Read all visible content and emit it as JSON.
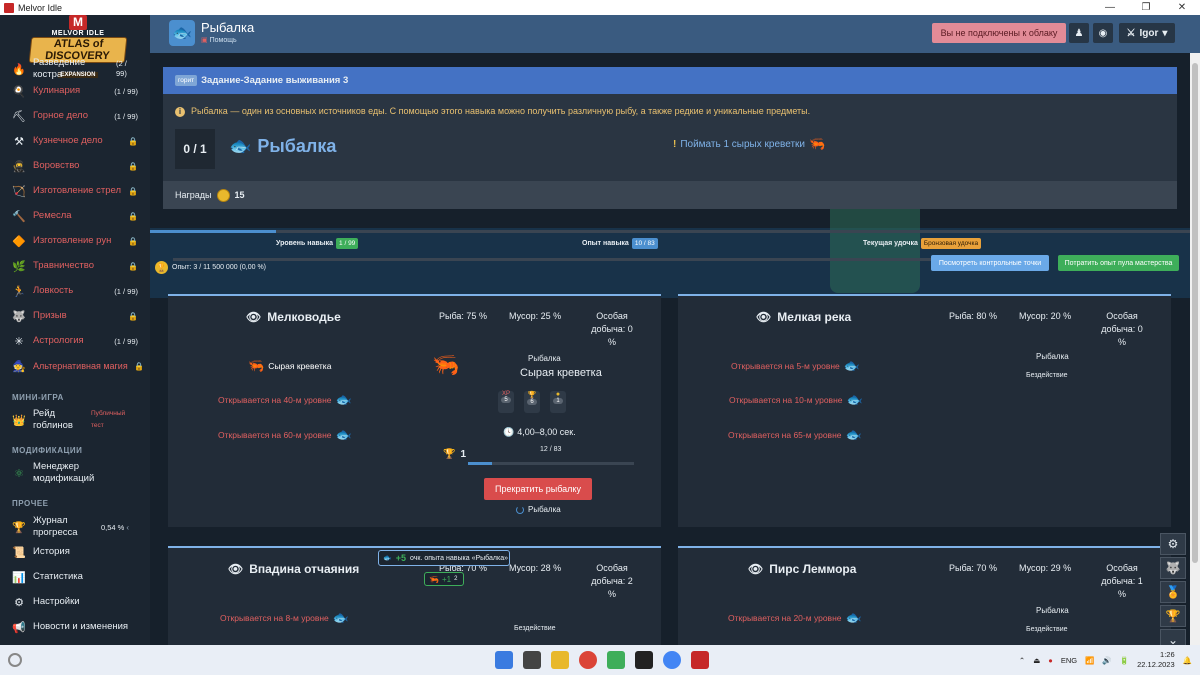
{
  "window": {
    "title": "Melvor Idle",
    "min": "—",
    "max": "❐",
    "close": "✕"
  },
  "logo": {
    "line1": "MELVOR IDLE",
    "line2": "ATLAS of DISCOVERY",
    "line3": "EXPANSION"
  },
  "sidebar": {
    "skills": [
      {
        "label": "Разведение костра",
        "count": "(2 / 99)",
        "locked": false,
        "icon": "flame-icon",
        "glyph": "🔥"
      },
      {
        "label": "Кулинария",
        "count": "(1 / 99)",
        "locked": false,
        "icon": "chef-hat-icon",
        "glyph": "🍳"
      },
      {
        "label": "Горное дело",
        "count": "(1 / 99)",
        "locked": false,
        "icon": "pickaxe-icon",
        "glyph": "⛏"
      },
      {
        "label": "Кузнечное дело",
        "count": "",
        "locked": true,
        "icon": "anvil-icon",
        "glyph": "⚒"
      },
      {
        "label": "Воровство",
        "count": "",
        "locked": true,
        "icon": "thief-icon",
        "glyph": "🥷"
      },
      {
        "label": "Изготовление стрел",
        "count": "",
        "locked": true,
        "icon": "arrows-icon",
        "glyph": "🏹"
      },
      {
        "label": "Ремесла",
        "count": "",
        "locked": true,
        "icon": "crafting-icon",
        "glyph": "🔨"
      },
      {
        "label": "Изготовление рун",
        "count": "",
        "locked": true,
        "icon": "rune-icon",
        "glyph": "🔶"
      },
      {
        "label": "Травничество",
        "count": "",
        "locked": true,
        "icon": "herb-icon",
        "glyph": "🌿"
      },
      {
        "label": "Ловкость",
        "count": "(1 / 99)",
        "locked": false,
        "icon": "agility-icon",
        "glyph": "🏃"
      },
      {
        "label": "Призыв",
        "count": "",
        "locked": true,
        "icon": "wolf-icon",
        "glyph": "🐺"
      },
      {
        "label": "Астрология",
        "count": "(1 / 99)",
        "locked": false,
        "icon": "astrology-icon",
        "glyph": "✳"
      },
      {
        "label": "Альтернативная магия",
        "count": "",
        "locked": true,
        "icon": "wizard-hat-icon",
        "glyph": "🧙"
      }
    ],
    "minigame_heading": "МИНИ-ИГРА",
    "minigame": {
      "label": "Рейд гоблинов",
      "note": "Публичный тест"
    },
    "mods_heading": "МОДИФИКАЦИИ",
    "mods": {
      "label": "Менеджер модификаций"
    },
    "other_heading": "ПРОЧЕЕ",
    "other": [
      {
        "label": "Журнал прогресса",
        "extra": "0,54 %",
        "icon": "trophy-icon",
        "glyph": "🏆"
      },
      {
        "label": "История",
        "extra": "",
        "icon": "history-icon",
        "glyph": "📜"
      },
      {
        "label": "Статистика",
        "extra": "",
        "icon": "stats-icon",
        "glyph": "📊"
      },
      {
        "label": "Настройки",
        "extra": "",
        "icon": "gear-icon",
        "glyph": "⚙"
      },
      {
        "label": "Новости и изменения",
        "extra": "",
        "icon": "megaphone-icon",
        "glyph": "📢"
      }
    ]
  },
  "topbar": {
    "skill_title": "Рыбалка",
    "help": "Помощь",
    "cloud_status": "Вы не подключены к облаку",
    "user": "Igor"
  },
  "quest": {
    "tag": "горит",
    "title": "Задание-Задание выживания 3",
    "info": "Рыбалка — один из основных источников еды. С помощью этого навыка можно получить различную рыбу, а также редкие и уникальные предметы.",
    "counter": "0 / 1",
    "name": "Рыбалка",
    "goal": "Поймать 1 сырых креветки",
    "rewards_label": "Награды",
    "rewards_value": "15"
  },
  "skill_stats": {
    "level_label": "Уровень навыка",
    "level_value": "1 / 99",
    "xp_label": "Опыт навыка",
    "xp_value": "10 / 83",
    "rod_label": "Текущая удочка",
    "rod_value": "Бронзовая удочка",
    "mastery_text": "Опыт: 3 / 11 500 000 (0,00 %)",
    "btn_checkpoints": "Посмотреть контрольные точки",
    "btn_pool": "Потратить опыт пула мастерства"
  },
  "areas": [
    {
      "name": "Мелководье",
      "fish_chance": "Рыба: 75 %",
      "junk_chance": "Мусор: 25 %",
      "special_chance": "Особая добыча: 0 %",
      "fish": [
        {
          "label": "Сырая креветка",
          "locked": false
        },
        {
          "label": "Открывается на 40-м уровне",
          "locked": true
        },
        {
          "label": "Открывается на 60-м уровне",
          "locked": true
        }
      ],
      "selected_caption": "Рыбалка",
      "selected_name": "Сырая креветка",
      "chips": [
        {
          "label": "XP",
          "n": "5"
        },
        {
          "label": "🏆",
          "n": "6"
        },
        {
          "label": "●",
          "n": "1"
        }
      ],
      "interval": "4,00–8,00 сек.",
      "mastery_level": "1",
      "mastery_progress": "12 / 83",
      "mastery_fraction": 0.145,
      "stop_btn": "Прекратить рыбалку",
      "status": "Рыбалка"
    },
    {
      "name": "Мелкая река",
      "fish_chance": "Рыба: 80 %",
      "junk_chance": "Мусор: 20 %",
      "special_chance": "Особая добыча: 0 %",
      "fish": [
        {
          "label": "Открывается на 5-м уровне",
          "locked": true
        },
        {
          "label": "Открывается на 10-м уровне",
          "locked": true
        },
        {
          "label": "Открывается на 65-м уровне",
          "locked": true
        }
      ],
      "selected_caption": "Рыбалка",
      "status": "Бездействие"
    },
    {
      "name": "Впадина отчаяния",
      "fish_chance": "Рыба: 70 %",
      "junk_chance": "Мусор: 28 %",
      "special_chance": "Особая добыча: 2 %",
      "fish": [
        {
          "label": "Открывается на 8-м уровне",
          "locked": true
        }
      ],
      "status": "Бездействие"
    },
    {
      "name": "Пирс Леммора",
      "fish_chance": "Рыба: 70 %",
      "junk_chance": "Мусор: 29 %",
      "special_chance": "Особая добыча: 1 %",
      "fish": [
        {
          "label": "Открывается на 20-м уровне",
          "locked": true
        }
      ],
      "selected_caption": "Рыбалка",
      "status": "Бездействие"
    }
  ],
  "toasts": {
    "xp": "+5",
    "xp_text": "очк. опыта навыка «Рыбалка»",
    "item": "+1",
    "item_n": "2"
  },
  "taskbar": {
    "lang": "ENG",
    "time": "1:26",
    "date": "22.12.2023"
  },
  "colors": {
    "accent": "#4b8fcf",
    "locked": "#e06060",
    "success": "#3eae5a",
    "danger": "#d94c4c"
  }
}
